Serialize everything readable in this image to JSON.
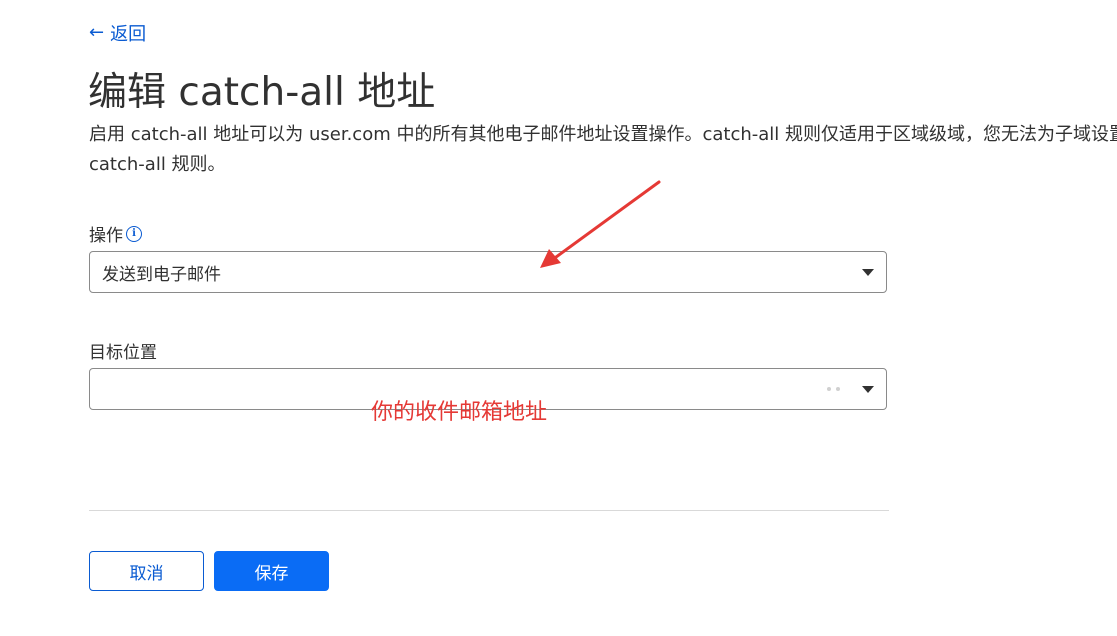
{
  "nav": {
    "back_arrow": "←",
    "back_label": "返回"
  },
  "header": {
    "title": "编辑 catch-all 地址",
    "description": "启用 catch-all 地址可以为 user.com 中的所有其他电子邮件地址设置操作。catch-all 规则仅适用于区域级域，您无法为子域设置 catch-all 规则。"
  },
  "form": {
    "action_label": "操作",
    "action_info_icon": "info-icon",
    "action_value": "发送到电子邮件",
    "destination_label": "目标位置",
    "destination_value": ""
  },
  "annotation": {
    "text": "你的收件邮箱地址",
    "color": "#e53935"
  },
  "footer": {
    "cancel_label": "取消",
    "save_label": "保存"
  },
  "colors": {
    "accent": "#0a5bd2",
    "primary_button": "#0a6cf5",
    "annotation": "#e53935"
  }
}
